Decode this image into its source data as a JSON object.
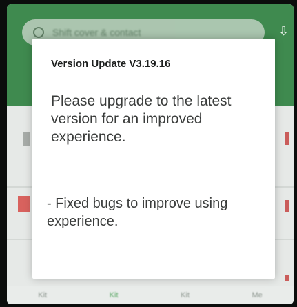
{
  "background_app": {
    "search_placeholder": "Shift cover & contact",
    "bottom_nav": [
      "Kit",
      "Kit",
      "Kit",
      "Me"
    ]
  },
  "dialog": {
    "title": "Version Update V3.19.16",
    "message": "Please upgrade to the latest version for an improved experience.",
    "notes": "- Fixed bugs to improve using experience."
  },
  "colors": {
    "header_green": "#3f8a4f",
    "dialog_bg": "#ffffff"
  }
}
